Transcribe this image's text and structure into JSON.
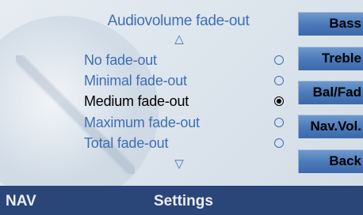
{
  "menu": {
    "title": "Audiovolume fade-out",
    "scroll_up_symbol": "△",
    "scroll_down_symbol": "▽",
    "options": [
      {
        "label": "No fade-out",
        "selected": false
      },
      {
        "label": "Minimal fade-out",
        "selected": false
      },
      {
        "label": "Medium fade-out",
        "selected": true
      },
      {
        "label": "Maximum fade-out",
        "selected": false
      },
      {
        "label": "Total fade-out",
        "selected": false
      }
    ]
  },
  "side_buttons": [
    {
      "label": "Bass"
    },
    {
      "label": "Treble"
    },
    {
      "label": "Bal/Fad"
    },
    {
      "label": "Nav.Vol."
    },
    {
      "label": "Back"
    }
  ],
  "bottom_bar": {
    "left_label": "NAV",
    "center_label": "Settings"
  },
  "colors": {
    "option_text": "#3f6fb4",
    "selected_text": "#000000",
    "button_blue": "#4a78b8",
    "bottom_bar": "#2a4578"
  }
}
